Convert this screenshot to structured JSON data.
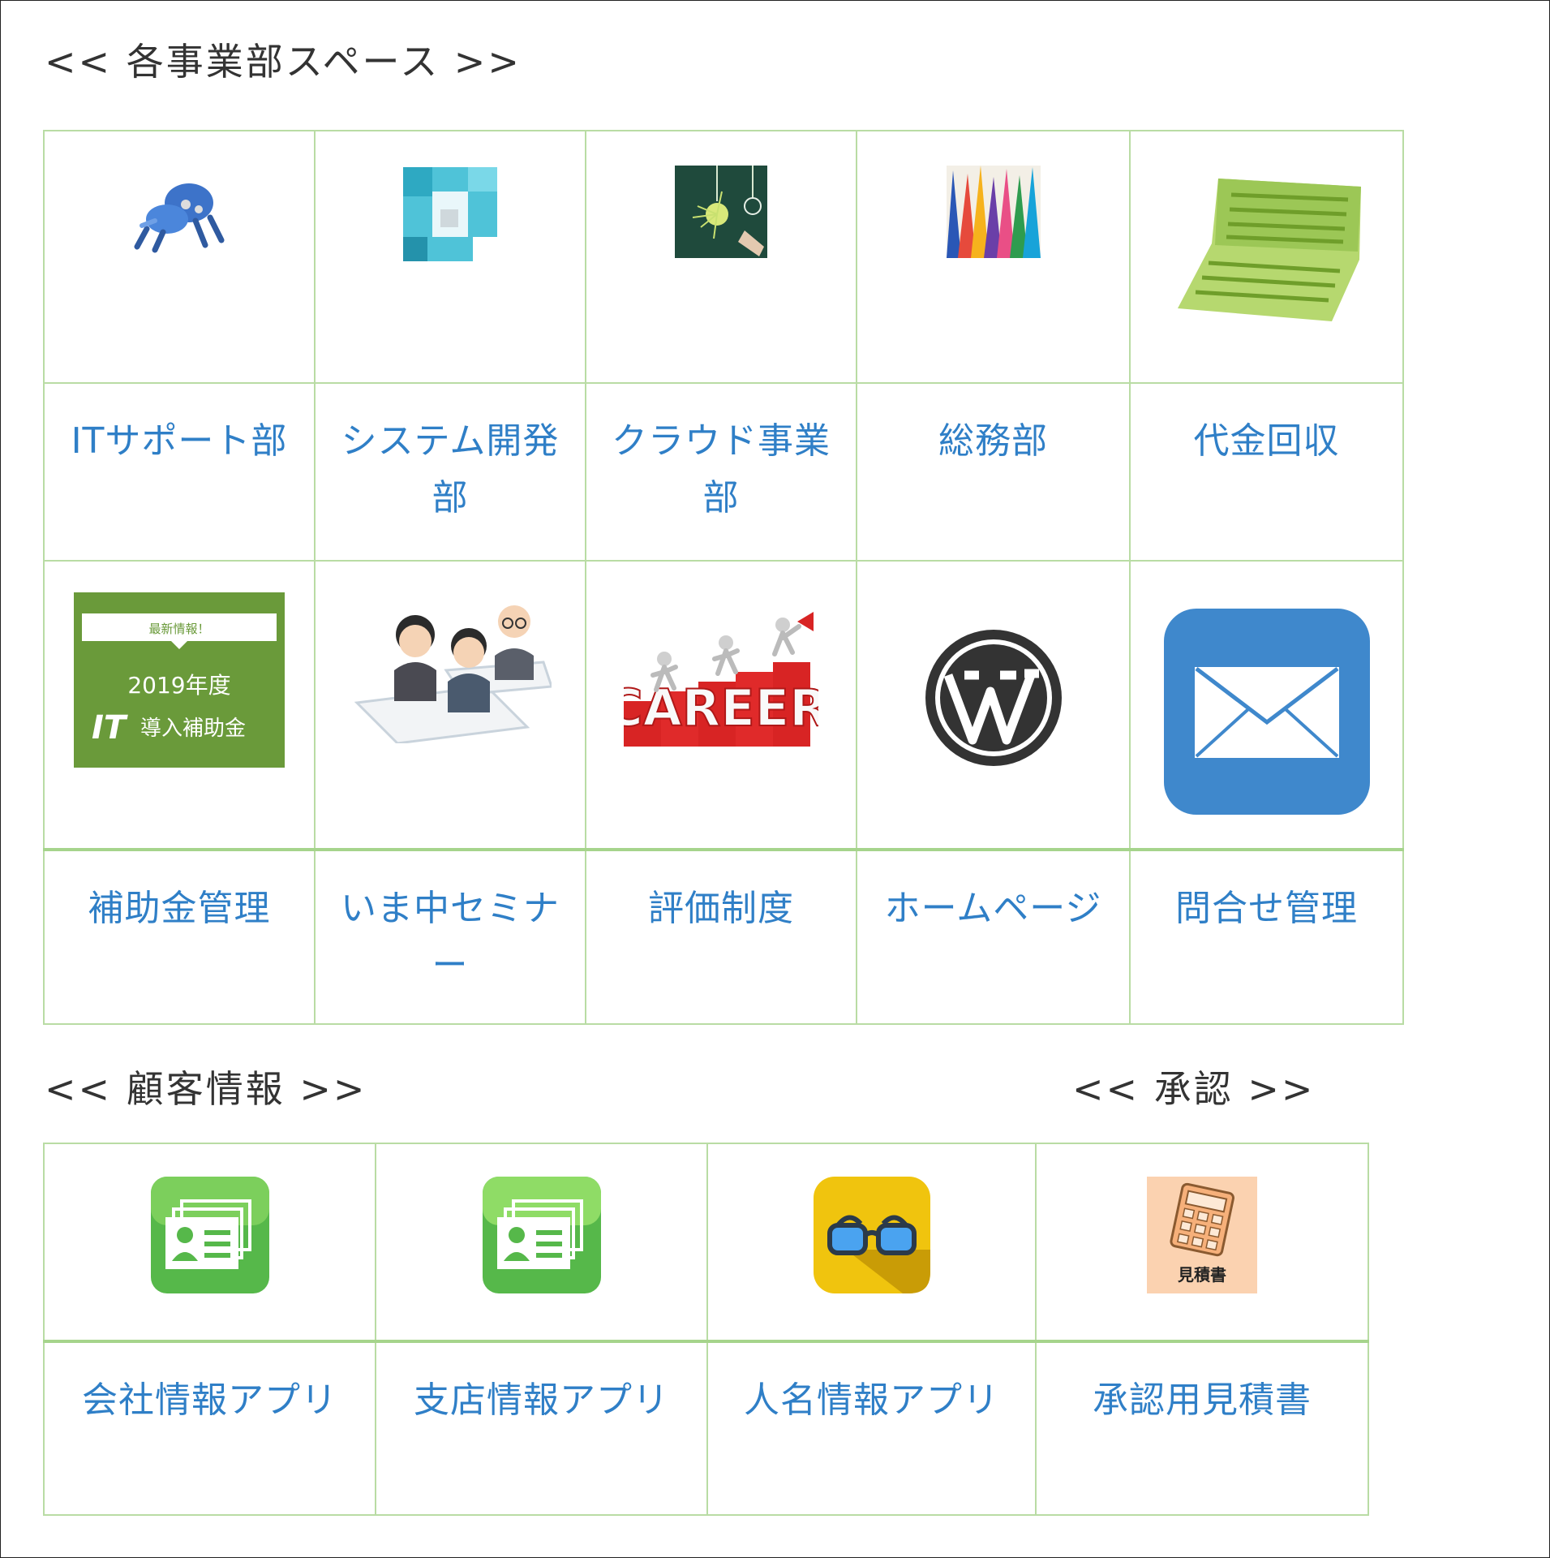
{
  "sections": {
    "departments_heading": "<< 各事業部スペース >>",
    "customer_heading": "<< 顧客情報 >>",
    "approval_heading": "<< 承認 >>"
  },
  "departments": [
    {
      "label": "ITサポート部",
      "icon": "robot-icon"
    },
    {
      "label": "システム開発部",
      "icon": "blocks-icon"
    },
    {
      "label": "クラウド事業部",
      "icon": "lightbulb-chalkboard-icon"
    },
    {
      "label": "総務部",
      "icon": "colored-pencils-icon"
    },
    {
      "label": "代金回収",
      "icon": "bankbook-icon"
    },
    {
      "label": "補助金管理",
      "icon": "subsidy-banner-icon",
      "banner": {
        "top": "最新情報！",
        "year": "2019年度",
        "title_it": "IT",
        "title_rest": "導入補助金"
      }
    },
    {
      "label": "いま中セミナー",
      "icon": "seminar-people-icon"
    },
    {
      "label": "評価制度",
      "icon": "career-icon",
      "text": "CAREER"
    },
    {
      "label": "ホームページ",
      "icon": "wordpress-icon"
    },
    {
      "label": "問合せ管理",
      "icon": "mail-icon"
    }
  ],
  "customer_apps": [
    {
      "label": "会社情報アプリ",
      "icon": "business-card-icon"
    },
    {
      "label": "支店情報アプリ",
      "icon": "business-card-icon"
    },
    {
      "label": "人名情報アプリ",
      "icon": "glasses-icon"
    },
    {
      "label": "承認用見積書",
      "icon": "calculator-estimate-icon",
      "text": "見積書"
    }
  ],
  "colors": {
    "link": "#2f7fc7",
    "grid_border": "#b9dca4",
    "heading": "#333333"
  }
}
